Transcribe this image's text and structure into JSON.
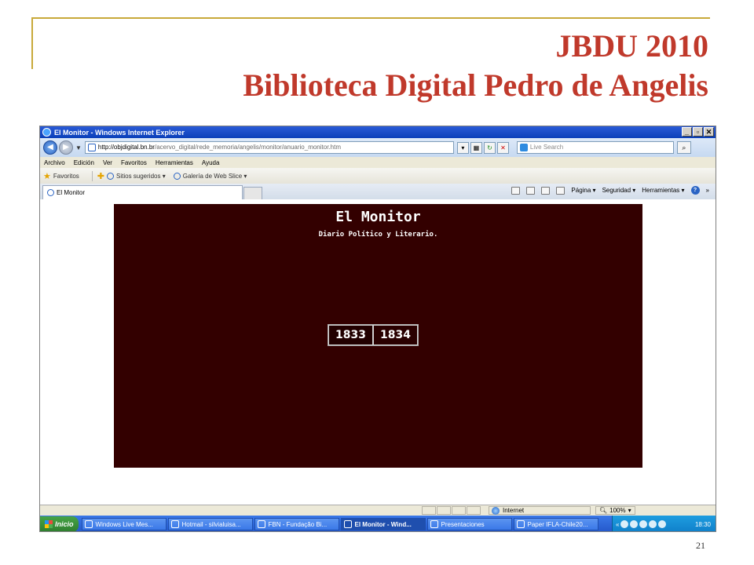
{
  "slide": {
    "title_line1": "JBDU 2010",
    "title_line2": "Biblioteca Digital Pedro de Angelis",
    "page_number": "21"
  },
  "colors": {
    "title": "#c0392b",
    "accent": "#c8a93a",
    "content_bg": "#330000"
  },
  "browser": {
    "window_title": "El Monitor - Windows Internet Explorer",
    "url_host": "http://objdigital.bn.br",
    "url_path": "/acervo_digital/rede_memoria/angelis/monitor/anuario_monitor.htm",
    "search_placeholder": "Live Search",
    "menu": [
      "Archivo",
      "Edición",
      "Ver",
      "Favoritos",
      "Herramientas",
      "Ayuda"
    ],
    "favorites": {
      "label": "Favoritos",
      "items": [
        "Sitios sugeridos ▾",
        "Galería de Web Slice ▾"
      ]
    },
    "tab": {
      "label": "El Monitor"
    },
    "commands": [
      "Página ▾",
      "Seguridad ▾",
      "Herramientas ▾"
    ],
    "status": {
      "zone": "Internet",
      "zoom": "100%"
    }
  },
  "page": {
    "title": "El Monitor",
    "subtitle": "Diario Político y Literario.",
    "years": [
      "1833",
      "1834"
    ]
  },
  "taskbar": {
    "start": "Inicio",
    "items": [
      "Windows Live Mes...",
      "Hotmail - silvialuisa...",
      "FBN - Fundação Bi...",
      "El Monitor - Wind...",
      "Presentaciones",
      "Paper IFLA-Chile20..."
    ],
    "clock": "18:30"
  }
}
